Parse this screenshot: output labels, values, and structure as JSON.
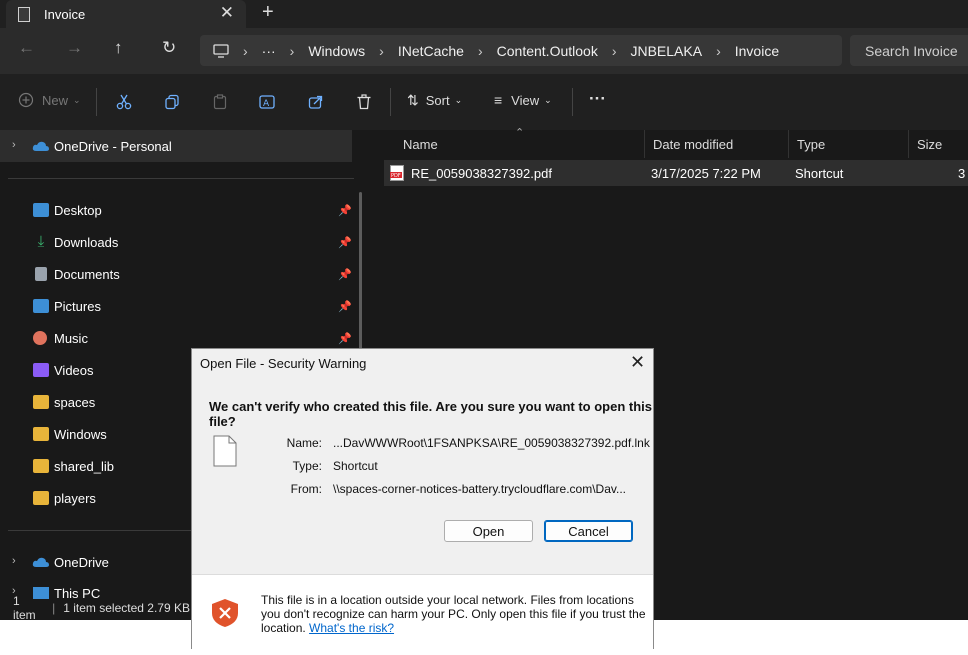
{
  "window": {
    "tab_title": "Invoice",
    "new_tab": "+"
  },
  "nav": {
    "breadcrumb": [
      "Windows",
      "INetCache",
      "Content.Outlook",
      "JNBELAKA",
      "Invoice"
    ],
    "ellipsis": "···",
    "search_placeholder": "Search Invoice"
  },
  "toolbar": {
    "new_label": "New",
    "sort_label": "Sort",
    "view_label": "View",
    "more": "···"
  },
  "sidebar": {
    "onedrive_personal": "OneDrive - Personal",
    "items": [
      {
        "label": "Desktop",
        "color": "#3d8fd6"
      },
      {
        "label": "Downloads",
        "color": "#3ab26f"
      },
      {
        "label": "Documents",
        "color": "#9aa3ad"
      },
      {
        "label": "Pictures",
        "color": "#3d8fd6"
      },
      {
        "label": "Music",
        "color": "#e0735d"
      },
      {
        "label": "Videos",
        "color": "#8b5cf6"
      },
      {
        "label": "spaces",
        "color": "#e8b43a"
      },
      {
        "label": "Windows",
        "color": "#e8b43a"
      },
      {
        "label": "shared_lib",
        "color": "#e8b43a"
      },
      {
        "label": "players",
        "color": "#e8b43a"
      }
    ],
    "onedrive": "OneDrive",
    "this_pc": "This PC"
  },
  "columns": {
    "name": "Name",
    "date": "Date modified",
    "type": "Type",
    "size": "Size"
  },
  "file": {
    "name": "RE_0059038327392.pdf",
    "date": "3/17/2025 7:22 PM",
    "type": "Shortcut",
    "size": "3"
  },
  "status": {
    "count": "1 item",
    "selected": "1 item selected  2.79 KB"
  },
  "dialog": {
    "title": "Open File - Security Warning",
    "heading": "We can't verify who created this file. Are you sure you want to open this file?",
    "name_label": "Name:",
    "name_value": "...DavWWWRoot\\1FSANPKSA\\RE_0059038327392.pdf.lnk",
    "type_label": "Type:",
    "type_value": "Shortcut",
    "from_label": "From:",
    "from_value": "\\\\spaces-corner-notices-battery.trycloudflare.com\\Dav...",
    "open_label": "Open",
    "cancel_label": "Cancel",
    "warning_text": "This file is in a location outside your local network. Files from locations you don't recognize can harm your PC. Only open this file if you trust the location.",
    "risk_link": "What's the risk?"
  }
}
